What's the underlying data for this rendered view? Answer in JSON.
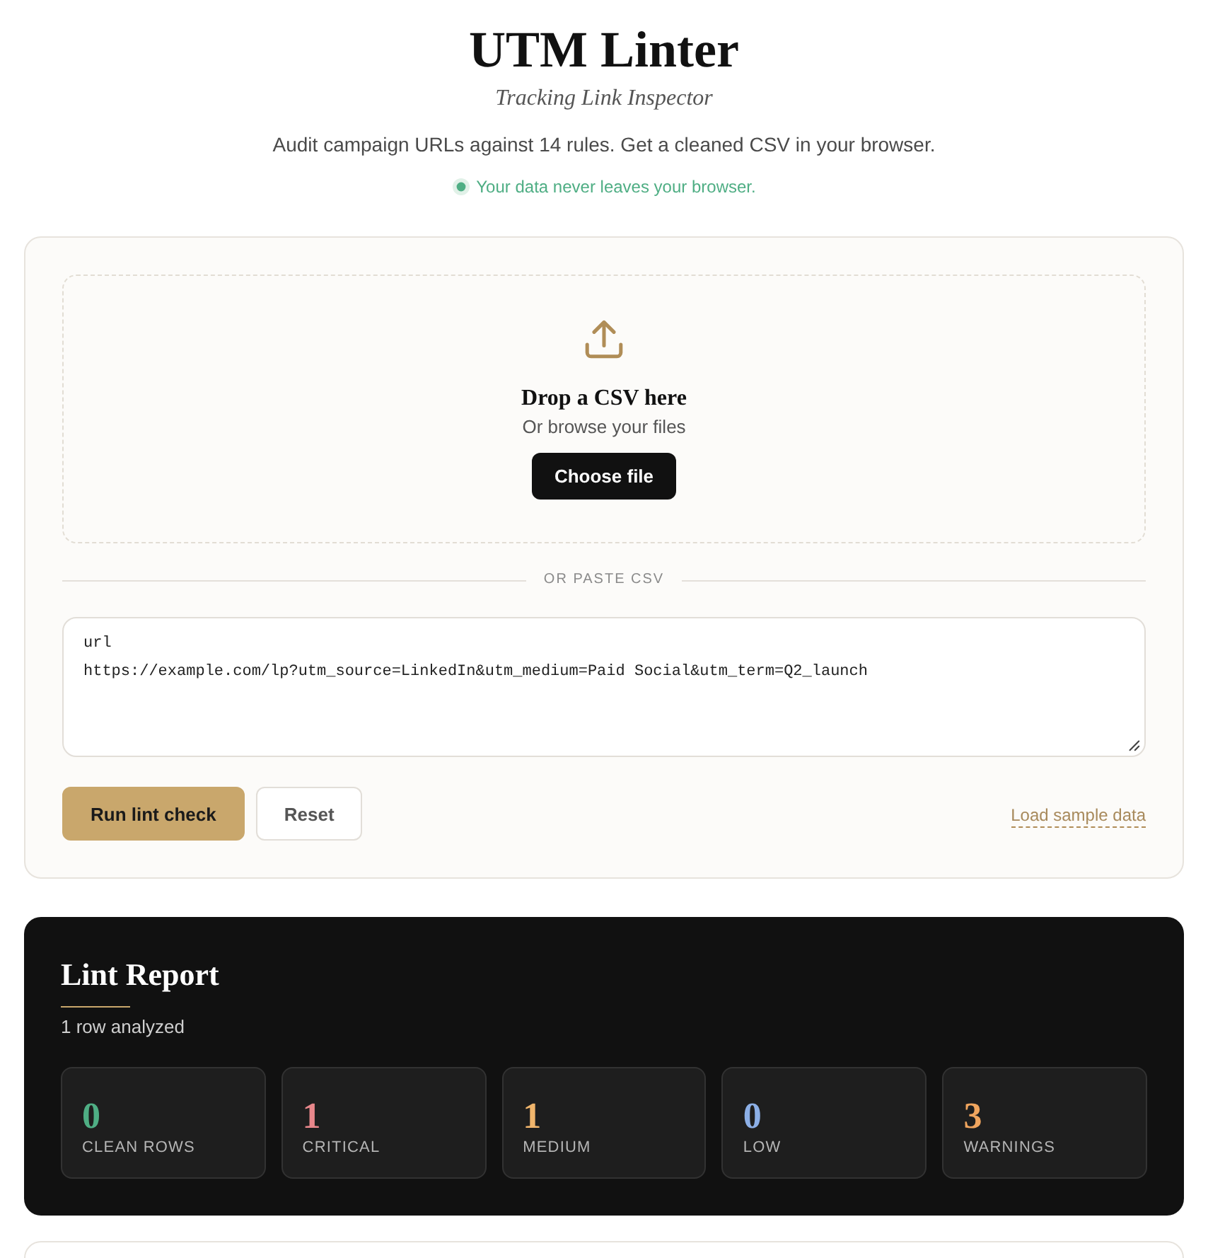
{
  "header": {
    "title": "UTM Linter",
    "subtitle": "Tracking Link Inspector",
    "description": "Audit campaign URLs against 14 rules. Get a cleaned CSV in your browser.",
    "privacy_note": "Your data never leaves your browser."
  },
  "upload": {
    "dropzone": {
      "title": "Drop a CSV here",
      "hint": "Or browse your files",
      "button": "Choose file"
    },
    "divider": "OR PASTE CSV",
    "csv_input": {
      "value": "url\nhttps://example.com/lp?utm_source=LinkedIn&utm_medium=Paid Social&utm_term=Q2_launch"
    },
    "buttons": [
      {
        "label": "Run lint check",
        "kind": "primary"
      },
      {
        "label": "Reset",
        "kind": "secondary"
      }
    ],
    "sample_link": "Load sample data"
  },
  "report": {
    "title": "Lint Report",
    "summary": "1 row analyzed",
    "stats": [
      {
        "value": "0",
        "label": "CLEAN ROWS",
        "color": "#4fae84"
      },
      {
        "value": "1",
        "label": "CRITICAL",
        "color": "#e8878b"
      },
      {
        "value": "1",
        "label": "MEDIUM",
        "color": "#f0b56c"
      },
      {
        "value": "0",
        "label": "LOW",
        "color": "#8cafe6"
      },
      {
        "value": "3",
        "label": "WARNINGS",
        "color": "#f0a55e"
      }
    ]
  }
}
